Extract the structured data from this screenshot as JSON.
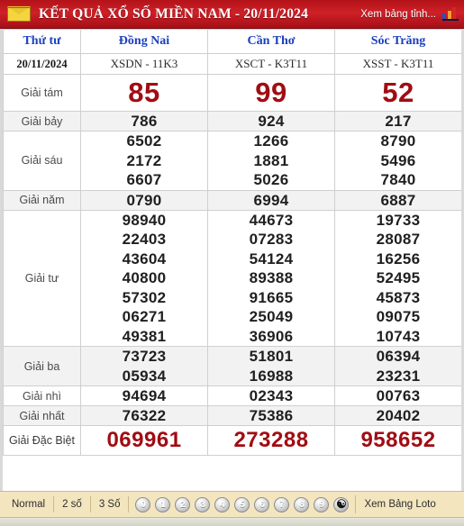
{
  "header": {
    "envelope_icon": "envelope-icon",
    "title": "KẾT QUẢ XỔ SỐ MIỀN NAM - 20/11/2024",
    "right_link": "Xem bảng tỉnh...",
    "chart_icon": "bar-chart-icon",
    "bg_color": "#cf2027",
    "text_color": "#ffffff"
  },
  "table": {
    "columns": [
      "Thứ tư",
      "Đồng Nai",
      "Cần Thơ",
      "Sóc Trăng"
    ],
    "date": "20/11/2024",
    "codes": [
      "XSDN - 11K3",
      "XSCT - K3T11",
      "XSST - K3T11"
    ],
    "accent_red": "#a00d13",
    "rows": [
      {
        "label": "Giải tám",
        "style": "big-red",
        "values": [
          [
            "85"
          ],
          [
            "99"
          ],
          [
            "52"
          ]
        ]
      },
      {
        "label": "Giải bảy",
        "style": "num",
        "values": [
          [
            "786"
          ],
          [
            "924"
          ],
          [
            "217"
          ]
        ]
      },
      {
        "label": "Giải sáu",
        "style": "num",
        "values": [
          [
            "6502",
            "2172",
            "6607"
          ],
          [
            "1266",
            "1881",
            "5026"
          ],
          [
            "8790",
            "5496",
            "7840"
          ]
        ]
      },
      {
        "label": "Giải năm",
        "style": "num",
        "values": [
          [
            "0790"
          ],
          [
            "6994"
          ],
          [
            "6887"
          ]
        ]
      },
      {
        "label": "Giải tư",
        "style": "num",
        "values": [
          [
            "98940",
            "22403",
            "43604",
            "40800",
            "57302",
            "06271",
            "49381"
          ],
          [
            "44673",
            "07283",
            "54124",
            "89388",
            "91665",
            "25049",
            "36906"
          ],
          [
            "19733",
            "28087",
            "16256",
            "52495",
            "45873",
            "09075",
            "10743"
          ]
        ]
      },
      {
        "label": "Giải ba",
        "style": "num",
        "values": [
          [
            "73723",
            "05934"
          ],
          [
            "51801",
            "16988"
          ],
          [
            "06394",
            "23231"
          ]
        ]
      },
      {
        "label": "Giải nhì",
        "style": "num",
        "values": [
          [
            "94694"
          ],
          [
            "02343"
          ],
          [
            "00763"
          ]
        ]
      },
      {
        "label": "Giải nhất",
        "style": "num",
        "values": [
          [
            "76322"
          ],
          [
            "75386"
          ],
          [
            "20402"
          ]
        ]
      },
      {
        "label": "Giải Đặc Biệt",
        "style": "db-red",
        "values": [
          [
            "069961"
          ],
          [
            "273288"
          ],
          [
            "958652"
          ]
        ]
      }
    ]
  },
  "footer": {
    "mode_normal": "Normal",
    "mode_2so": "2 số",
    "mode_3so": "3 Số",
    "balls": [
      "0",
      "1",
      "2",
      "3",
      "4",
      "5",
      "6",
      "7",
      "8",
      "9"
    ],
    "yin_yang_icon": "☯",
    "loto_link": "Xem Bảng Loto",
    "bg_color": "#f3e6bf"
  }
}
